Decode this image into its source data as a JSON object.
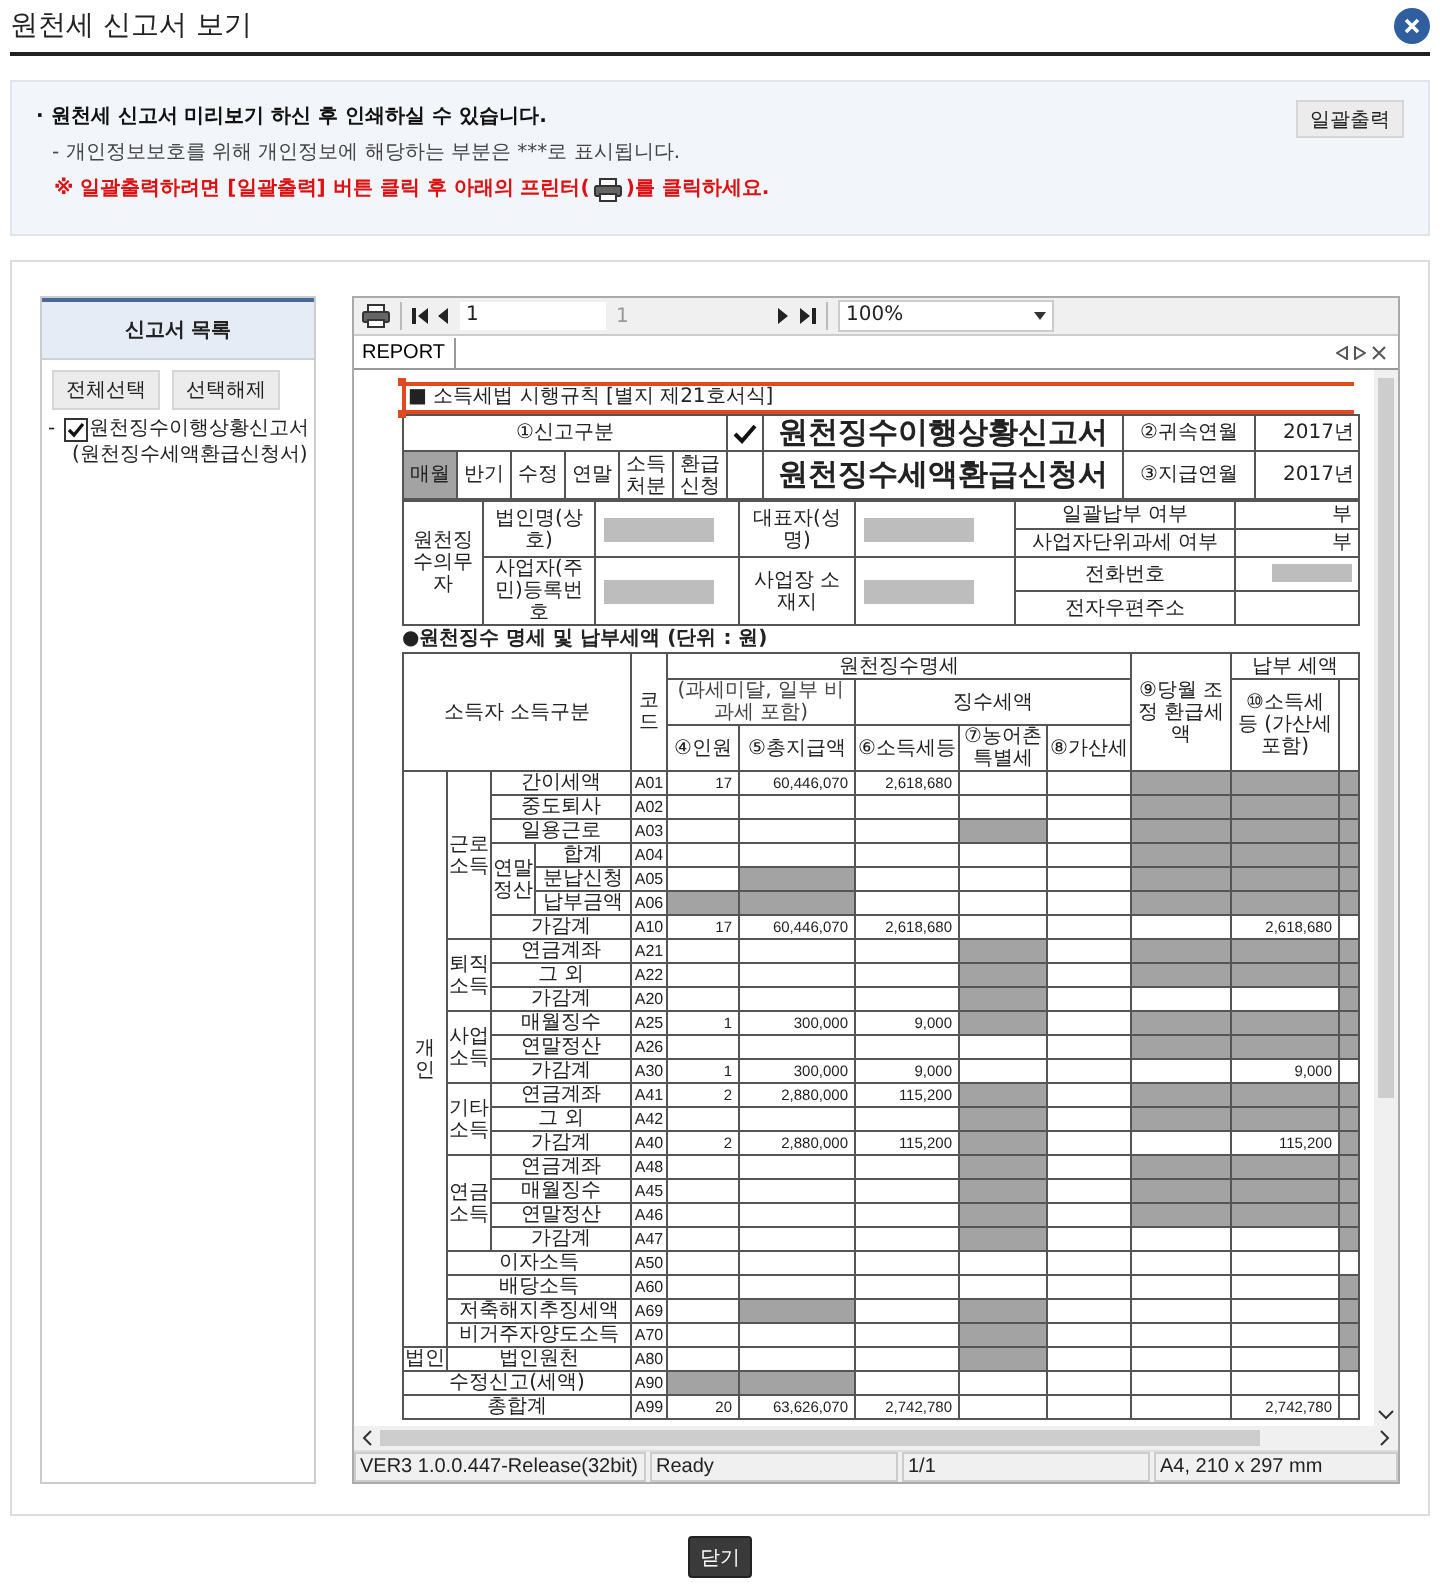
{
  "window": {
    "title": "원천세 신고서 보기"
  },
  "notice": {
    "lines": [
      {
        "kind": "bullet",
        "text": "· 원천세 신고서 미리보기 하신 후 인쇄하실 수 있습니다."
      },
      {
        "kind": "note",
        "text": "- 개인정보보호를 위해 개인정보에 해당하는 부분은 ***로 표시됩니다."
      },
      {
        "kind": "warning",
        "text": "※ 일괄출력하려면 [일괄출력] 버튼 클릭 후 아래의 프린터(",
        "text_after": ")를 클릭하세요."
      }
    ],
    "print_all_button": "일괄출력"
  },
  "report_list": {
    "title": "신고서 목록",
    "buttons": [
      "전체선택",
      "선택해제"
    ],
    "items": [
      {
        "prefix": "-",
        "label": "원천징수이행상황신고서",
        "sublabel": "(원천징수세액환급신청서)",
        "checked": true
      }
    ]
  },
  "viewer": {
    "toolbar": {
      "page": "1",
      "page_count": "1",
      "zoom": "100%"
    },
    "tab": "REPORT",
    "status_bar": [
      "VER3 1.0.0.447-Release(32bit)",
      "Ready",
      "1/1",
      "A4, 210 x 297 mm"
    ]
  },
  "report": {
    "form_ref": "■ 소득세법 시행규칙 [별지 제21호서식]",
    "report_type": {
      "label": "①신고구분",
      "options": [
        {
          "label": "매월",
          "selected": true
        },
        {
          "label": "반기",
          "selected": false
        },
        {
          "label": "수정",
          "selected": false
        },
        {
          "label": "연말",
          "selected": false
        },
        {
          "label": "소득처분",
          "selected": false
        },
        {
          "label": "환급신청",
          "selected": false
        }
      ]
    },
    "titles": [
      {
        "text": "원천징수이행상황신고서",
        "checked": true
      },
      {
        "text": "원천징수세액환급신청서",
        "checked": false
      }
    ],
    "periods": [
      {
        "label": "②귀속연월",
        "value": "2017년"
      },
      {
        "label": "③지급연월",
        "value": "2017년"
      }
    ],
    "payer": {
      "label": "원천징수의무자",
      "fields": [
        {
          "label": "법인명(상호)",
          "redacted": true
        },
        {
          "label": "대표자(성명)",
          "redacted": true
        },
        {
          "label": "사업자(주민)등록번호",
          "redacted": true
        },
        {
          "label": "사업장 소재지",
          "redacted": true
        }
      ],
      "side": [
        {
          "label": "일괄납부 여부",
          "value": "부",
          "redacted": false
        },
        {
          "label": "사업자단위과세 여부",
          "value": "부",
          "redacted": false
        },
        {
          "label": "전화번호",
          "redacted": true
        },
        {
          "label": "전자우편주소",
          "redacted": false
        }
      ]
    },
    "withholding": {
      "title": "●원천징수 명세 및 납부세액 (단위 : 원)",
      "header": {
        "category": "소득자 소득구분",
        "code": "코드",
        "details": "원천징수명세",
        "non_taxable_note": "(과세미달, 일부 비과세 포함)",
        "collected": "징수세액",
        "columns": [
          "④인원",
          "⑤총지급액",
          "⑥소득세등",
          "⑦농어촌특별세",
          "⑧가산세"
        ],
        "adjusted_refund": "⑨당월 조정 환급세액",
        "payment": "납부 세액",
        "income_tax_total": "⑩소득세 등 (가산세 포함)"
      },
      "rows": [
        {
          "label": "개인",
          "children": [
            {
              "label": "근로소득",
              "children": [
                {
                  "label": "간이세액",
                  "code": "A01",
                  "values": {
                    "persons": "17",
                    "total_paid": "60,446,070",
                    "income_tax": "2,618,680"
                  },
                  "shaded": [
                    false,
                    false,
                    false,
                    false,
                    false,
                    true,
                    true,
                    true
                  ]
                },
                {
                  "label": "중도퇴사",
                  "code": "A02",
                  "shaded": [
                    false,
                    false,
                    false,
                    false,
                    false,
                    true,
                    true,
                    true
                  ]
                },
                {
                  "label": "일용근로",
                  "code": "A03",
                  "shaded": [
                    false,
                    false,
                    false,
                    true,
                    false,
                    true,
                    true,
                    true
                  ]
                },
                {
                  "label": "연말정산",
                  "children": [
                    {
                      "label": "합계",
                      "code": "A04",
                      "shaded": [
                        false,
                        false,
                        false,
                        false,
                        false,
                        true,
                        true,
                        true
                      ]
                    },
                    {
                      "label": "분납신청",
                      "code": "A05",
                      "shaded": [
                        false,
                        true,
                        false,
                        false,
                        false,
                        true,
                        true,
                        true
                      ]
                    },
                    {
                      "label": "납부금액",
                      "code": "A06",
                      "shaded": [
                        true,
                        true,
                        false,
                        false,
                        false,
                        true,
                        true,
                        true
                      ]
                    }
                  ]
                },
                {
                  "label": "가감계",
                  "code": "A10",
                  "values": {
                    "persons": "17",
                    "total_paid": "60,446,070",
                    "income_tax": "2,618,680",
                    "income_tax_total": "2,618,680"
                  },
                  "shaded": [
                    false,
                    false,
                    false,
                    false,
                    false,
                    false,
                    false,
                    false
                  ]
                }
              ]
            },
            {
              "label": "퇴직소득",
              "children": [
                {
                  "label": "연금계좌",
                  "code": "A21",
                  "shaded": [
                    false,
                    false,
                    false,
                    true,
                    false,
                    true,
                    true,
                    true
                  ]
                },
                {
                  "label": "그 외",
                  "code": "A22",
                  "shaded": [
                    false,
                    false,
                    false,
                    true,
                    false,
                    true,
                    true,
                    true
                  ]
                },
                {
                  "label": "가감계",
                  "code": "A20",
                  "shaded": [
                    false,
                    false,
                    false,
                    true,
                    false,
                    false,
                    false,
                    true
                  ]
                }
              ]
            },
            {
              "label": "사업소득",
              "children": [
                {
                  "label": "매월징수",
                  "code": "A25",
                  "values": {
                    "persons": "1",
                    "total_paid": "300,000",
                    "income_tax": "9,000"
                  },
                  "shaded": [
                    false,
                    false,
                    false,
                    true,
                    false,
                    true,
                    true,
                    true
                  ]
                },
                {
                  "label": "연말정산",
                  "code": "A26",
                  "shaded": [
                    false,
                    false,
                    false,
                    false,
                    false,
                    true,
                    true,
                    true
                  ]
                },
                {
                  "label": "가감계",
                  "code": "A30",
                  "values": {
                    "persons": "1",
                    "total_paid": "300,000",
                    "income_tax": "9,000",
                    "income_tax_total": "9,000"
                  },
                  "shaded": [
                    false,
                    false,
                    false,
                    false,
                    false,
                    false,
                    false,
                    false
                  ]
                }
              ]
            },
            {
              "label": "기타소득",
              "children": [
                {
                  "label": "연금계좌",
                  "code": "A41",
                  "values": {
                    "persons": "2",
                    "total_paid": "2,880,000",
                    "income_tax": "115,200"
                  },
                  "shaded": [
                    false,
                    false,
                    false,
                    true,
                    false,
                    true,
                    true,
                    true
                  ]
                },
                {
                  "label": "그 외",
                  "code": "A42",
                  "shaded": [
                    false,
                    false,
                    false,
                    true,
                    false,
                    true,
                    true,
                    true
                  ]
                },
                {
                  "label": "가감계",
                  "code": "A40",
                  "values": {
                    "persons": "2",
                    "total_paid": "2,880,000",
                    "income_tax": "115,200",
                    "income_tax_total": "115,200"
                  },
                  "shaded": [
                    false,
                    false,
                    false,
                    true,
                    false,
                    false,
                    false,
                    true
                  ]
                }
              ]
            },
            {
              "label": "연금소득",
              "children": [
                {
                  "label": "연금계좌",
                  "code": "A48",
                  "shaded": [
                    false,
                    false,
                    false,
                    true,
                    false,
                    true,
                    true,
                    true
                  ]
                },
                {
                  "label": "매월징수",
                  "code": "A45",
                  "shaded": [
                    false,
                    false,
                    false,
                    true,
                    false,
                    true,
                    true,
                    true
                  ]
                },
                {
                  "label": "연말정산",
                  "code": "A46",
                  "shaded": [
                    false,
                    false,
                    false,
                    true,
                    false,
                    true,
                    true,
                    true
                  ]
                },
                {
                  "label": "가감계",
                  "code": "A47",
                  "shaded": [
                    false,
                    false,
                    false,
                    true,
                    false,
                    false,
                    false,
                    true
                  ]
                }
              ]
            },
            {
              "label": "이자소득",
              "code": "A50",
              "shaded": [
                false,
                false,
                false,
                false,
                false,
                false,
                false,
                false
              ]
            },
            {
              "label": "배당소득",
              "code": "A60",
              "shaded": [
                false,
                false,
                false,
                false,
                false,
                false,
                false,
                true
              ]
            },
            {
              "label": "저축해지추징세액",
              "code": "A69",
              "shaded": [
                false,
                true,
                false,
                true,
                false,
                false,
                false,
                true
              ]
            },
            {
              "label": "비거주자양도소득",
              "code": "A70",
              "shaded": [
                false,
                false,
                false,
                true,
                false,
                false,
                false,
                true
              ]
            }
          ]
        },
        {
          "label": "법인",
          "children": [
            {
              "label": "법인원천",
              "code": "A80",
              "shaded": [
                false,
                false,
                false,
                true,
                false,
                false,
                false,
                true
              ]
            }
          ]
        },
        {
          "label": "수정신고(세액)",
          "code": "A90",
          "shaded": [
            true,
            true,
            false,
            false,
            false,
            false,
            false,
            false
          ]
        },
        {
          "label": "총합계",
          "code": "A99",
          "values": {
            "persons": "20",
            "total_paid": "63,626,070",
            "income_tax": "2,742,780",
            "income_tax_total": "2,742,780"
          },
          "shaded": [
            false,
            false,
            false,
            false,
            false,
            false,
            false,
            false
          ]
        }
      ]
    }
  },
  "close_button": "닫기"
}
